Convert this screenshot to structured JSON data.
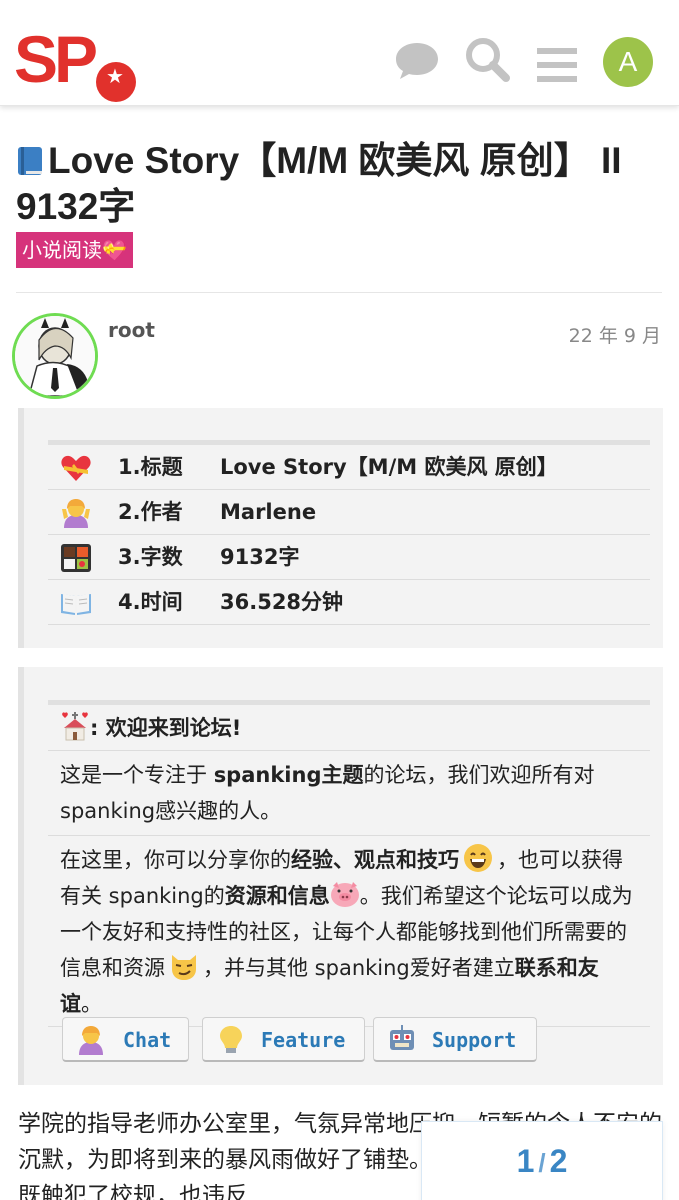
{
  "header": {
    "logo_text": "SP",
    "avatar_letter": "A",
    "icons": [
      "chat-icon",
      "search-icon",
      "hamburger-menu-icon"
    ]
  },
  "topic": {
    "title": "Love Story【M/M 欧美风 原创】 II 9132字",
    "category": "小说阅读💝",
    "category_color": "#d6337b"
  },
  "post": {
    "username": "root",
    "date": "22 年 9 月",
    "info_rows": [
      {
        "icon": "heart-ribbon-icon",
        "key": "1.标题",
        "value": "Love Story【M/M 欧美风 原创】"
      },
      {
        "icon": "person-gesturing-icon",
        "key": "2.作者",
        "value": "Marlene"
      },
      {
        "icon": "bento-box-icon",
        "key": "3.字数",
        "value": "9132字"
      },
      {
        "icon": "open-book-icon",
        "key": "4.时间",
        "value": "36.528分钟"
      }
    ],
    "welcome": {
      "heading": ": 欢迎来到论坛!",
      "p1_a": "这是一个专注于 ",
      "p1_b": "spanking主题",
      "p1_c": "的论坛，我们欢迎所有对 spanking感兴趣的人。",
      "p2_a": "在这里，你可以分享你的",
      "p2_b": "经验、观点和技巧",
      "p2_c": "，也可以获得有关 spanking的",
      "p2_d": "资源和信息",
      "p2_e": "。我们希望这个论坛可以成为一个友好和支持性的社区，让每个人都能够找到他们所需要的信息和资源",
      "p2_f": "，并与其他 spanking爱好者建立",
      "p2_g": "联系和友谊",
      "p2_h": "。"
    },
    "buttons": [
      {
        "label": "Chat",
        "icon": "person-gesturing-icon"
      },
      {
        "label": "Feature",
        "icon": "light-bulb-icon"
      },
      {
        "label": "Support",
        "icon": "robot-icon"
      }
    ],
    "body_text": "学院的指导老师办公室里，气氛异常地压抑，短暂的令人不安的沉默，为即将到来的暴风雨做好了铺垫。你要知道，这样的行为既触犯了校规，也违反"
  },
  "pagination": {
    "current": "1",
    "separator": "/",
    "total": "2"
  },
  "colors": {
    "logo_red": "#e1312c",
    "avatar_green": "#9dc34a",
    "link_blue": "#2c7ab6",
    "online_ring": "#6fdc52"
  }
}
